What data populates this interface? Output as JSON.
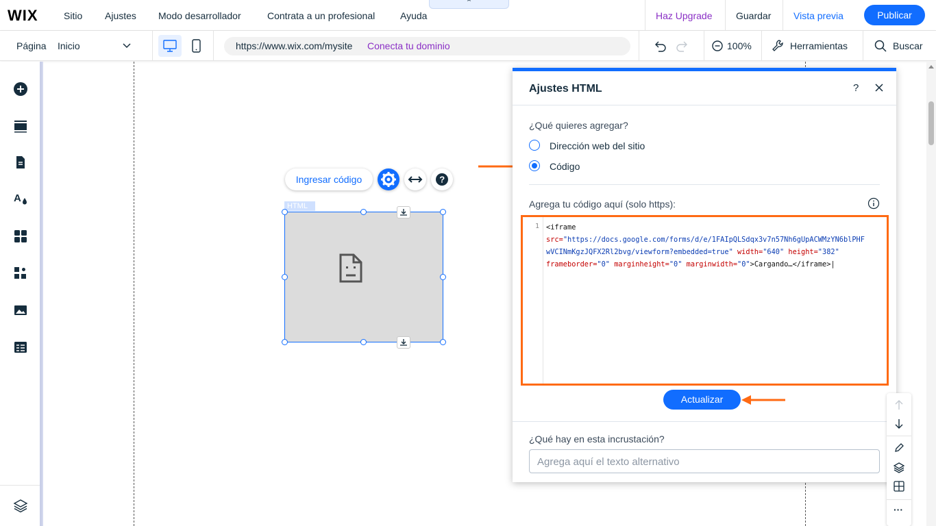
{
  "topbar": {
    "logo": "WIX",
    "menu": [
      "Sitio",
      "Ajustes",
      "Modo desarrollador",
      "Contrata a un profesional",
      "Ayuda"
    ],
    "upgrade": "Haz Upgrade",
    "save": "Guardar",
    "preview": "Vista previa",
    "publish": "Publicar",
    "collapse_icon": "chevron-up"
  },
  "pagebar": {
    "page_label": "Página",
    "page_value": "Inicio",
    "url": "https://www.wix.com/mysite",
    "connect_domain": "Conecta tu dominio",
    "zoom": "100%",
    "tools": "Herramientas",
    "search": "Buscar"
  },
  "sidebar": {
    "items": [
      "add-icon",
      "sections-icon",
      "pages-icon",
      "theme-icon",
      "apps-icon",
      "business-apps-icon",
      "media-icon",
      "cms-icon"
    ],
    "bottom": "layers-icon"
  },
  "element": {
    "enter_code": "Ingresar código",
    "tag": "HTML"
  },
  "panel": {
    "title": "Ajustes HTML",
    "question": "¿Qué quieres agregar?",
    "options": [
      {
        "label": "Dirección web del sitio",
        "selected": false
      },
      {
        "label": "Código",
        "selected": true
      }
    ],
    "code_label": "Agrega tu código aquí (solo https):",
    "code_line_number": "1",
    "code": {
      "line1_tag": "<iframe",
      "src_attr": "src=",
      "src_value_a": "\"https://docs.google.com/forms/d/e/1FAIpQLSdqx3v7n57Nh6gUpACWMzYN6blPHF",
      "src_value_b": "wVCINmKgzJQFX2Rl2bvg/viewform?embedded=true\"",
      "width_attr": "width=",
      "width_value": "\"640\"",
      "height_attr": "height=",
      "height_value": "\"382\"",
      "frameborder_attr": "frameborder=",
      "frameborder_value": "\"0\"",
      "marginheight_attr": "marginheight=",
      "marginheight_value": "\"0\"",
      "marginwidth_attr": "marginwidth=",
      "marginwidth_value": "\"0\"",
      "content": ">Cargando…</iframe>"
    },
    "update_button": "Actualizar",
    "embed_question": "¿Qué hay en esta incrustación?",
    "alt_placeholder": "Agrega aquí el texto alternativo"
  },
  "annotations": {
    "arrow_color": "#ff6a13"
  },
  "colors": {
    "accent": "#116dff",
    "upgrade": "#8a2fc5",
    "highlight": "#ff6a13"
  }
}
